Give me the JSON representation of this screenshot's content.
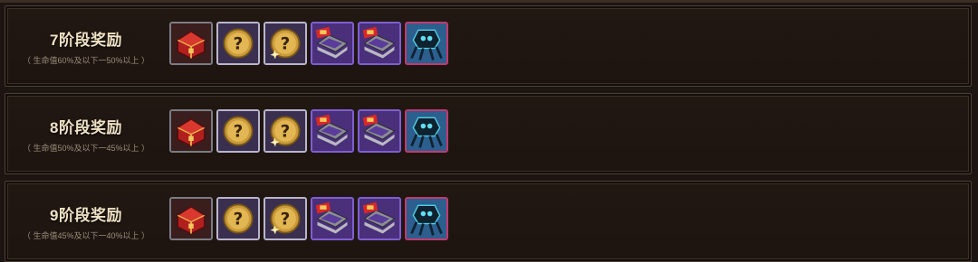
{
  "stages": [
    {
      "title": "7阶段奖励",
      "subtitle": "（ 生命值60%及以下一50%以上 ）",
      "rewards": [
        {
          "icon": "treasure-chest-icon",
          "rarity": "common"
        },
        {
          "icon": "mystery-gold-coin-icon",
          "rarity": "rare"
        },
        {
          "icon": "mystery-gold-coin-sparkle-icon",
          "rarity": "rare"
        },
        {
          "icon": "event-box-icon",
          "rarity": "epic"
        },
        {
          "icon": "event-box-icon",
          "rarity": "epic"
        },
        {
          "icon": "spider-mech-icon",
          "rarity": "legend"
        }
      ]
    },
    {
      "title": "8阶段奖励",
      "subtitle": "（ 生命值50%及以下一45%以上 ）",
      "rewards": [
        {
          "icon": "treasure-chest-icon",
          "rarity": "common"
        },
        {
          "icon": "mystery-gold-coin-icon",
          "rarity": "rare"
        },
        {
          "icon": "mystery-gold-coin-sparkle-icon",
          "rarity": "rare"
        },
        {
          "icon": "event-box-icon",
          "rarity": "epic"
        },
        {
          "icon": "event-box-icon",
          "rarity": "epic"
        },
        {
          "icon": "spider-mech-icon",
          "rarity": "legend"
        }
      ]
    },
    {
      "title": "9阶段奖励",
      "subtitle": "（ 生命值45%及以下一40%以上 ）",
      "rewards": [
        {
          "icon": "treasure-chest-icon",
          "rarity": "common"
        },
        {
          "icon": "mystery-gold-coin-icon",
          "rarity": "rare"
        },
        {
          "icon": "mystery-gold-coin-sparkle-icon",
          "rarity": "rare"
        },
        {
          "icon": "event-box-icon",
          "rarity": "epic"
        },
        {
          "icon": "event-box-icon",
          "rarity": "epic"
        },
        {
          "icon": "spider-mech-icon",
          "rarity": "legend"
        }
      ]
    }
  ]
}
